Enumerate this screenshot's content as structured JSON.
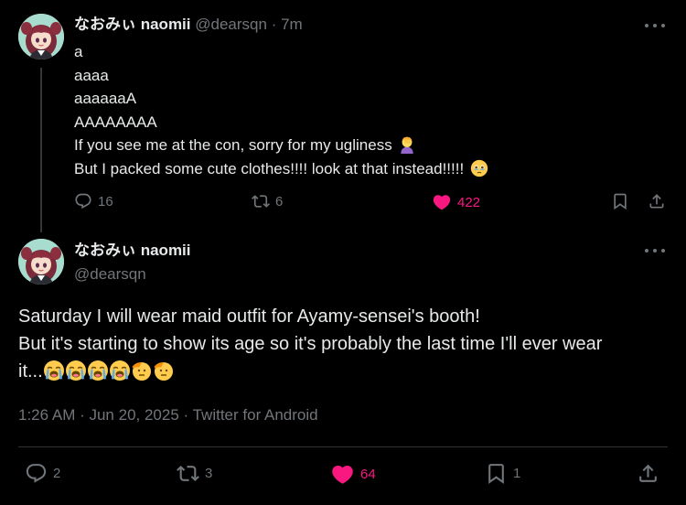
{
  "reply_tweet": {
    "author_name": "なおみぃ naomii",
    "handle": "@dearsqn",
    "separator": "·",
    "time_ago": "7m",
    "lines": [
      "a",
      "aaaa",
      "aaaaaaA",
      "AAAAAAAA",
      "If you see me at the con, sorry for my ugliness",
      "But I packed some cute clothes!!!! look at that instead!!!!!"
    ],
    "line_emojis": {
      "4": "person-facepalming-emoji",
      "5": "face-holding-back-tears-emoji"
    },
    "actions": {
      "replies": "16",
      "reposts": "6",
      "likes": "422"
    }
  },
  "main_tweet": {
    "author_name": "なおみぃ naomii",
    "handle": "@dearsqn",
    "lines": [
      "Saturday I will wear maid outfit for Ayamy-sensei's booth!",
      "But it's starting to show its age so it's probably the last time I'll ever wear",
      "it..."
    ],
    "trailing_emojis": [
      "loudly-crying-face-emoji",
      "loudly-crying-face-emoji",
      "loudly-crying-face-emoji",
      "loudly-crying-face-emoji",
      "saluting-face-emoji",
      "saluting-face-emoji"
    ],
    "timestamp": "1:26 AM · Jun 20, 2025",
    "source_separator": " · ",
    "source": "Twitter for Android",
    "actions": {
      "replies": "2",
      "reposts": "3",
      "likes": "64",
      "bookmarks": "1"
    }
  },
  "colors": {
    "background": "#000000",
    "text_primary": "#e7e9ea",
    "text_secondary": "#71767b",
    "like_pink": "#f91880",
    "divider": "#2f3336"
  }
}
